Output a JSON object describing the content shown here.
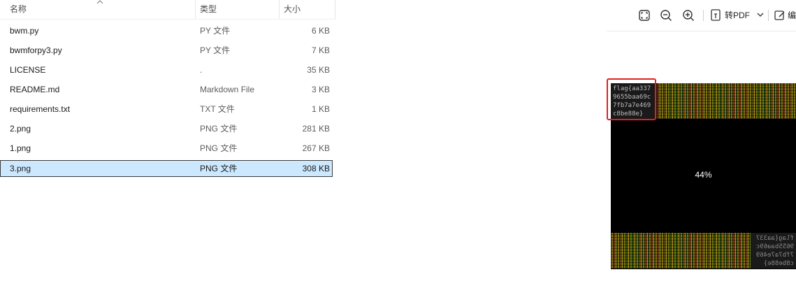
{
  "columns": {
    "name": "名称",
    "type": "类型",
    "size": "大小"
  },
  "files": [
    {
      "name": "bwm.py",
      "type": "PY 文件",
      "size": "6 KB"
    },
    {
      "name": "bwmforpy3.py",
      "type": "PY 文件",
      "size": "7 KB"
    },
    {
      "name": "LICENSE",
      "type": ".",
      "size": "35 KB"
    },
    {
      "name": "README.md",
      "type": "Markdown File",
      "size": "3 KB"
    },
    {
      "name": "requirements.txt",
      "type": "TXT 文件",
      "size": "1 KB"
    },
    {
      "name": "2.png",
      "type": "PNG 文件",
      "size": "281 KB"
    },
    {
      "name": "1.png",
      "type": "PNG 文件",
      "size": "267 KB"
    },
    {
      "name": "3.png",
      "type": "PNG 文件",
      "size": "308 KB",
      "selected": true
    }
  ],
  "preview": {
    "toolbar": {
      "fit_icon": "fit-to-window-icon",
      "zoom_out_icon": "zoom-out-icon",
      "zoom_in_icon": "zoom-in-icon",
      "convert_pdf_label": "转PDF",
      "edit_label": "编"
    },
    "zoom_label": "44%",
    "flag_text": "flag{aa337\n9655baa69c\n7fb7a7e469\nc8be88e}",
    "highlight_color": "#e02020"
  }
}
